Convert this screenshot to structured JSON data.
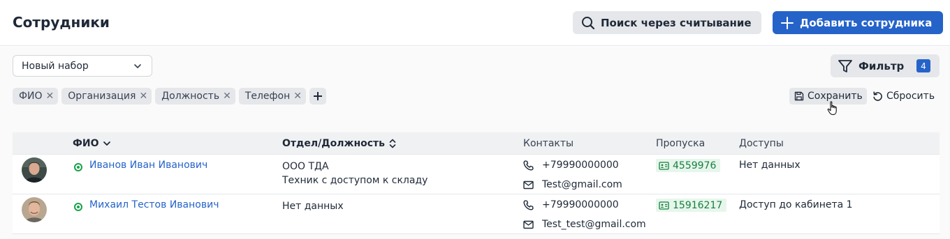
{
  "header": {
    "title": "Сотрудники",
    "scan_search_label": "Поиск через считывание",
    "add_employee_label": "Добавить сотрудника"
  },
  "toolbar": {
    "preset_select": "Новый набор",
    "filter_label": "Фильтр",
    "filter_count": "4",
    "save_label": "Сохранить",
    "reset_label": "Сбросить"
  },
  "columns_chips": [
    "ФИО",
    "Организация",
    "Должность",
    "Телефон"
  ],
  "table": {
    "headers": {
      "name": "ФИО",
      "dept": "Отдел/Должность",
      "contacts": "Контакты",
      "passes": "Пропуска",
      "access": "Доступы"
    },
    "rows": [
      {
        "name": "Иванов Иван Иванович",
        "org": "ООО ТДА",
        "position": "Техник с доступом к складу",
        "phone": "+79990000000",
        "email": "Test@gmail.com",
        "pass": "4559976",
        "access": "Нет данных"
      },
      {
        "name": "Михаил Тестов Иванович",
        "org": "Нет данных",
        "position": "",
        "phone": "+79990000000",
        "email": "Test_test@gmail.com",
        "pass": "15916217",
        "access": "Доступ до кабинета 1"
      }
    ]
  },
  "colors": {
    "accent": "#2563c9",
    "status_active": "#16a34a",
    "pass_bg": "#e7f6ec",
    "pass_text": "#15803d"
  }
}
